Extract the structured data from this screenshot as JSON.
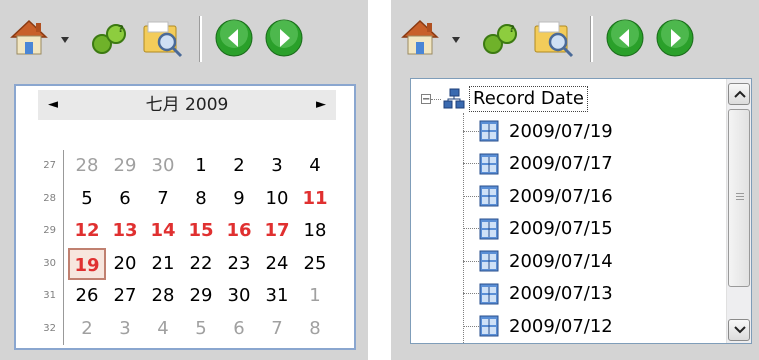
{
  "colors": {
    "panel_bg": "#d4d4d4",
    "calendar_border": "#8aa6cf",
    "weekend_red": "#e03030",
    "nav_green": "#2aa02a"
  },
  "toolbar": {
    "icons": [
      "home-icon",
      "dropdown-arrow-icon",
      "link-icon",
      "search-folder-icon",
      "back-icon",
      "forward-icon"
    ]
  },
  "calendar": {
    "prev_label": "◄",
    "next_label": "►",
    "title": "七月 2009",
    "weeks": [
      "27",
      "28",
      "29",
      "30",
      "31",
      "32"
    ],
    "rows": [
      [
        {
          "t": "28",
          "c": "other"
        },
        {
          "t": "29",
          "c": "other"
        },
        {
          "t": "30",
          "c": "other"
        },
        {
          "t": "1",
          "c": ""
        },
        {
          "t": "2",
          "c": ""
        },
        {
          "t": "3",
          "c": ""
        },
        {
          "t": "4",
          "c": ""
        }
      ],
      [
        {
          "t": "5",
          "c": ""
        },
        {
          "t": "6",
          "c": ""
        },
        {
          "t": "7",
          "c": ""
        },
        {
          "t": "8",
          "c": ""
        },
        {
          "t": "9",
          "c": ""
        },
        {
          "t": "10",
          "c": ""
        },
        {
          "t": "11",
          "c": "weekend"
        }
      ],
      [
        {
          "t": "12",
          "c": "weekend"
        },
        {
          "t": "13",
          "c": "weekend"
        },
        {
          "t": "14",
          "c": "weekend"
        },
        {
          "t": "15",
          "c": "weekend"
        },
        {
          "t": "16",
          "c": "weekend"
        },
        {
          "t": "17",
          "c": "weekend"
        },
        {
          "t": "18",
          "c": ""
        }
      ],
      [
        {
          "t": "19",
          "c": "selected today"
        },
        {
          "t": "20",
          "c": ""
        },
        {
          "t": "21",
          "c": ""
        },
        {
          "t": "22",
          "c": ""
        },
        {
          "t": "23",
          "c": ""
        },
        {
          "t": "24",
          "c": ""
        },
        {
          "t": "25",
          "c": ""
        }
      ],
      [
        {
          "t": "26",
          "c": ""
        },
        {
          "t": "27",
          "c": ""
        },
        {
          "t": "28",
          "c": ""
        },
        {
          "t": "29",
          "c": ""
        },
        {
          "t": "30",
          "c": ""
        },
        {
          "t": "31",
          "c": ""
        },
        {
          "t": "1",
          "c": "other"
        }
      ],
      [
        {
          "t": "2",
          "c": "other"
        },
        {
          "t": "3",
          "c": "other"
        },
        {
          "t": "4",
          "c": "other"
        },
        {
          "t": "5",
          "c": "other"
        },
        {
          "t": "6",
          "c": "other"
        },
        {
          "t": "7",
          "c": "other"
        },
        {
          "t": "8",
          "c": "other"
        }
      ]
    ]
  },
  "tree": {
    "expander": "−",
    "root_label": "Record Date",
    "items": [
      "2009/07/19",
      "2009/07/17",
      "2009/07/16",
      "2009/07/15",
      "2009/07/14",
      "2009/07/13",
      "2009/07/12"
    ]
  }
}
